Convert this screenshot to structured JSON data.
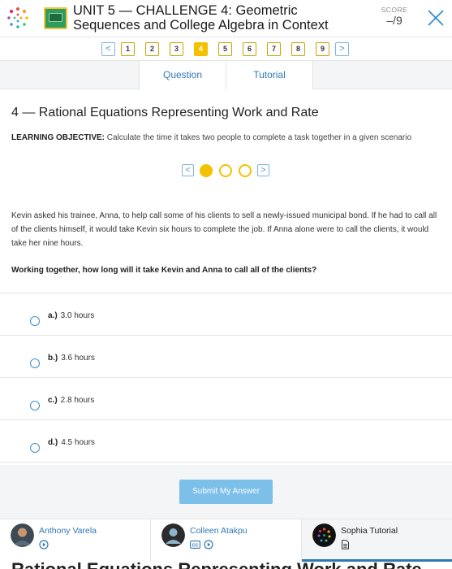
{
  "header": {
    "title_line1": "UNIT 5 — CHALLENGE 4: Geometric",
    "title_line2": "Sequences and College Algebra in Context",
    "score_label": "SCORE",
    "score_value": "–/9",
    "logo_icon": "sophia-logo-icon",
    "thumb_icon": "chalkboard-icon",
    "close_icon": "close-icon"
  },
  "pager": {
    "prev_label": "<",
    "next_label": ">",
    "pages": [
      "1",
      "2",
      "3",
      "4",
      "5",
      "6",
      "7",
      "8",
      "9"
    ],
    "current": "4"
  },
  "tabs": {
    "question": "Question",
    "tutorial": "Tutorial"
  },
  "question": {
    "title": "4 — Rational Equations Representing Work and Rate",
    "objective_label": "LEARNING OBJECTIVE:",
    "objective_text": "Calculate the time it takes two people to complete a task together in a given scenario",
    "step_prev": "<",
    "step_next": ">",
    "steps_total": 3,
    "step_current": 1,
    "passage": "Kevin asked his trainee, Anna, to help call some of his clients to sell a newly-issued municipal bond. If he had to call all of the clients himself, it would take Kevin six hours to complete the job. If Anna alone were to call the clients, it would take her nine hours.",
    "prompt": "Working together, how long will it take Kevin and Anna to call all of the clients?"
  },
  "answers": [
    {
      "letter": "a.)",
      "text": "3.0 hours"
    },
    {
      "letter": "b.)",
      "text": "3.6 hours"
    },
    {
      "letter": "c.)",
      "text": "2.8 hours"
    },
    {
      "letter": "d.)",
      "text": "4.5 hours"
    }
  ],
  "submit_label": "Submit My Answer",
  "tutors": [
    {
      "name": "Anthony Varela",
      "icons": [
        "play-icon"
      ]
    },
    {
      "name": "Colleen Atakpu",
      "icons": [
        "cc-icon",
        "play-icon"
      ]
    },
    {
      "name": "Sophia Tutorial",
      "icons": [
        "document-icon"
      ]
    }
  ],
  "cut_text": "Rational Equations Representing Work and Rate",
  "colors": {
    "accent_blue": "#2f78b5",
    "accent_yellow": "#f2c200",
    "submit_blue": "#7cc0ea",
    "radio_blue": "#3a8fd0"
  }
}
